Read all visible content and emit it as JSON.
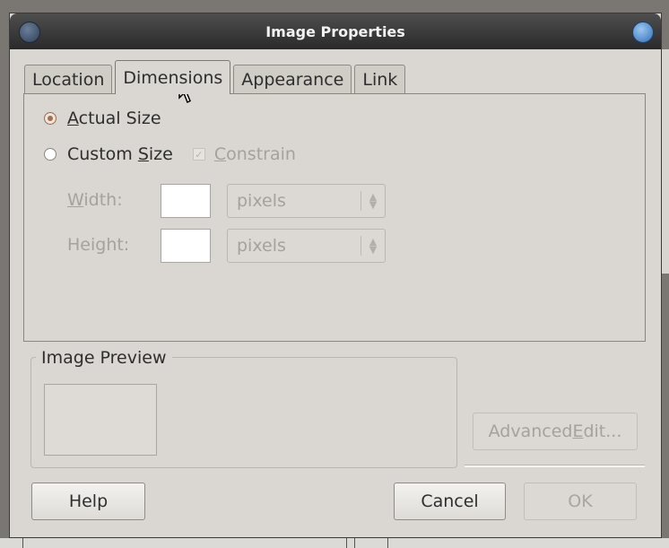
{
  "window": {
    "title": "Image Properties"
  },
  "tabs": [
    {
      "label": "Location",
      "active": false
    },
    {
      "label": "Dimensions",
      "active": true
    },
    {
      "label": "Appearance",
      "active": false
    },
    {
      "label": "Link",
      "active": false
    }
  ],
  "dimensions": {
    "actual_size": {
      "before": "",
      "mnemonic": "A",
      "after": "ctual Size",
      "selected": true
    },
    "custom_size": {
      "before": "Custom ",
      "mnemonic": "S",
      "after": "ize",
      "selected": false
    },
    "constrain": {
      "mnemonic": "C",
      "after": "onstrain",
      "checked": true,
      "enabled": false
    },
    "width": {
      "mnemonic": "W",
      "after": "idth:",
      "value": "",
      "unit": "pixels"
    },
    "height": {
      "label": "Height:",
      "value": "",
      "unit": "pixels"
    }
  },
  "preview": {
    "title": "Image Preview"
  },
  "advanced_edit": {
    "before": "Advanced ",
    "mnemonic": "E",
    "after": "dit..."
  },
  "buttons": {
    "help": "Help",
    "cancel": "Cancel",
    "ok": "OK"
  },
  "colors": {
    "titlebar": "#2a2a2a",
    "dialog_bg": "#dad7d2",
    "radio_selected": "#a07050"
  },
  "icons": {
    "cursor": "mouse-pointer-icon",
    "window_menu": "window-menu-icon",
    "window_close": "window-close-icon"
  }
}
